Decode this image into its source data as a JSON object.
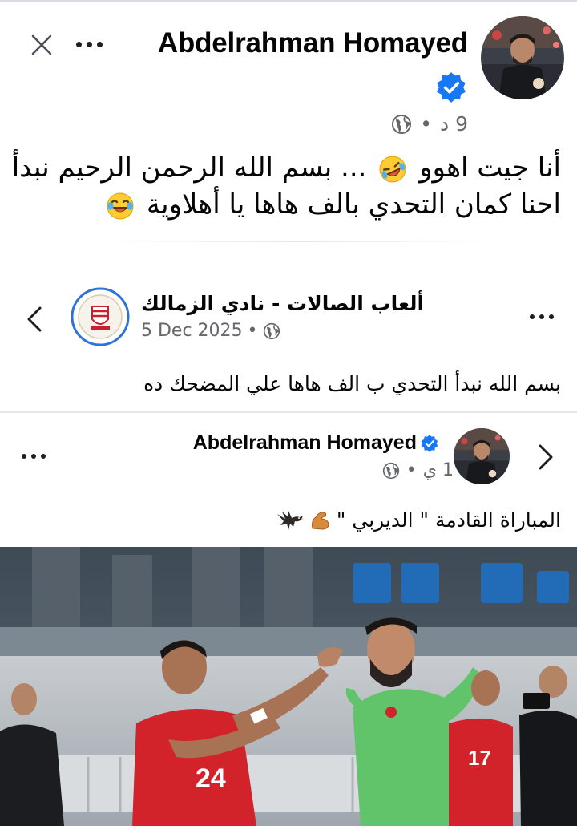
{
  "post": {
    "author": "Abdelrahman Homayed",
    "time": "9 د",
    "text_line1": "أنا جيت اهوو",
    "text_line1b": "... بسم الله الرحمن الرحيم  نبدأ",
    "text_line2": "احنا كمان التحدي بالف هاها يا أهلاوية"
  },
  "shared": {
    "page_name": "ألعاب الصالات - نادي الزمالك",
    "date": "5 Dec 2025",
    "text": "بسم الله نبدأ التحدي ب الف هاها علي المضحك ده"
  },
  "inner": {
    "author": "Abdelrahman Homayed",
    "time": "1 ي",
    "text": "المباراة القادمة \" الديربي \""
  },
  "icons": {
    "close": "close-icon",
    "more": "more-dots-icon",
    "verified": "verified-badge-icon",
    "globe": "globe-icon",
    "back": "chevron-left-icon",
    "forward": "chevron-right-icon",
    "laugh": "rofl-emoji-icon",
    "joy": "joy-emoji-icon",
    "muscle": "flexed-biceps-icon",
    "eagle": "eagle-icon"
  },
  "colors": {
    "verified_blue": "#1877f2",
    "meta_gray": "#65676b",
    "text": "#050505",
    "keeper_green": "#62c46a",
    "jersey_red": "#d3232a"
  }
}
